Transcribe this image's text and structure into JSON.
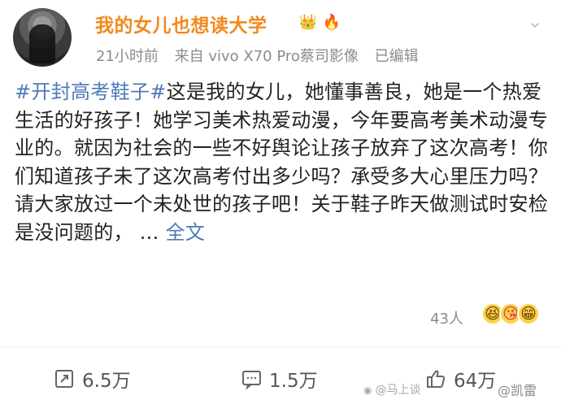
{
  "user": {
    "name": "我的女儿也想读大学",
    "badges": [
      "crown-badge",
      "flame-badge"
    ]
  },
  "meta": {
    "time": "21小时前",
    "source": "来自 vivo X70 Pro蔡司影像",
    "edited": "已编辑"
  },
  "post": {
    "topic": "#开封高考鞋子#",
    "text": "这是我的女儿，她懂事善良，她是一个热爱生活的好孩子！她学习美术热爱动漫，今年要高考美术动漫专业的。就因为社会的一些不好舆论让孩子放弃了这次高考！你们知道孩子未了这次高考付出多少吗？承受多大心里压力吗？请大家放过一个未处世的孩子吧！关于鞋子昨天做测试时安检是没问题的，",
    "ellipsis": "...",
    "full_text": "全文"
  },
  "reactions": {
    "count": "43人",
    "icons": [
      "laughing-face",
      "kiss-face",
      "grinning-face"
    ]
  },
  "actions": {
    "repost": "6.5万",
    "comment": "1.5万",
    "like": "64万"
  },
  "watermark": {
    "left": "@马上谈",
    "right": "@凯雷"
  }
}
